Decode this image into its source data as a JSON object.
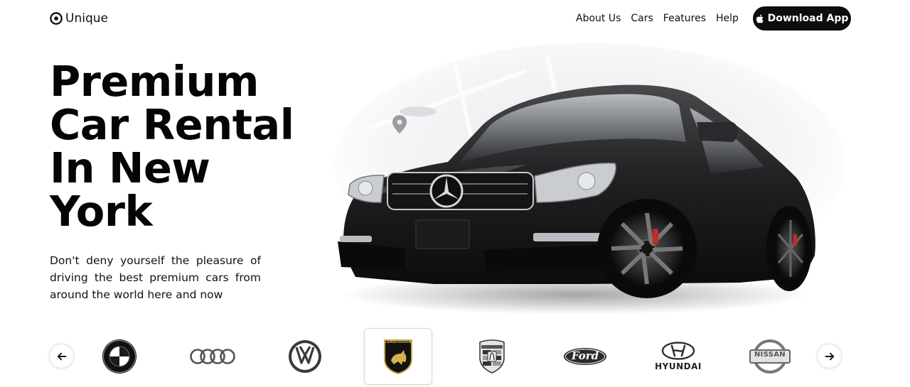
{
  "header": {
    "logo_text": "Unique",
    "nav": [
      "About Us",
      "Cars",
      "Features",
      "Help"
    ],
    "download_label": "Download App"
  },
  "hero": {
    "title_lines": [
      "Premium",
      "Car Rental",
      "In New",
      "York"
    ],
    "description": "Don't deny yourself the pleasure of driving the best premium cars from around the world here and now"
  },
  "brands": {
    "items": [
      "BMW",
      "Audi",
      "Volkswagen",
      "Lamborghini",
      "Porsche",
      "Ford",
      "Hyundai",
      "Nissan"
    ],
    "active": "Lamborghini",
    "hyundai_wordmark": "HYUNDAI",
    "ford_wordmark": "Ford",
    "nissan_wordmark": "NISSAN",
    "lamborghini_wordmark": "LAMBORGHINI"
  },
  "colors": {
    "accent": "#0d0d0d",
    "background": "#ffffff"
  }
}
